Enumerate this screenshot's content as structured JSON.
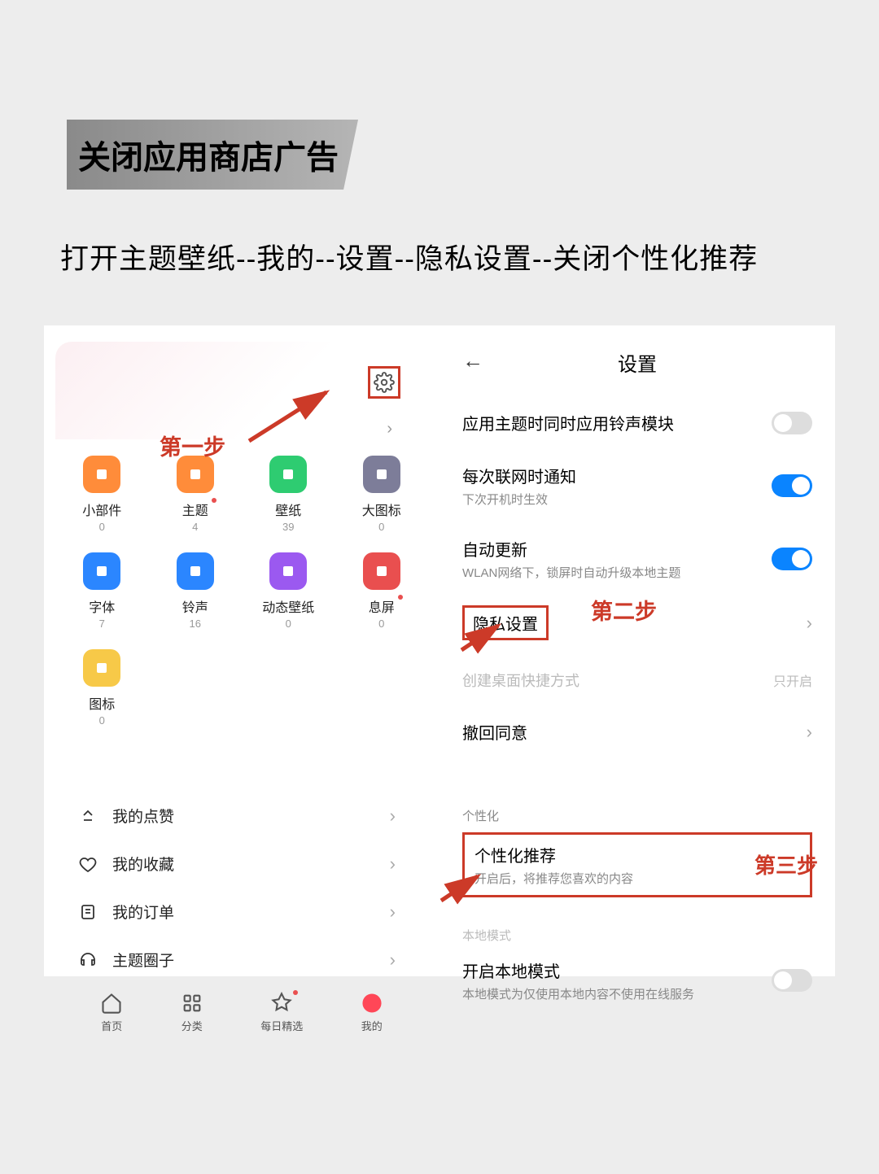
{
  "title": "关闭应用商店广告",
  "instruction": "打开主题壁纸--我的--设置--隐私设置--关闭个性化推荐",
  "step_labels": {
    "step1": "第一步",
    "step2": "第二步",
    "step3": "第三步"
  },
  "left": {
    "grid": [
      {
        "label": "小部件",
        "count": "0",
        "color": "#ff8c3a"
      },
      {
        "label": "主题",
        "count": "4",
        "color": "#ff8c3a",
        "dot": true
      },
      {
        "label": "壁纸",
        "count": "39",
        "color": "#2ecc71"
      },
      {
        "label": "大图标",
        "count": "0",
        "color": "#7d7d99"
      },
      {
        "label": "字体",
        "count": "7",
        "color": "#2b86ff"
      },
      {
        "label": "铃声",
        "count": "16",
        "color": "#2b86ff"
      },
      {
        "label": "动态壁纸",
        "count": "0",
        "color": "#9b59f0"
      },
      {
        "label": "息屏",
        "count": "0",
        "color": "#e94f4f",
        "dot": true
      },
      {
        "label": "图标",
        "count": "0",
        "color": "#f7c948"
      }
    ],
    "menu": [
      {
        "label": "我的点赞"
      },
      {
        "label": "我的收藏"
      },
      {
        "label": "我的订单"
      },
      {
        "label": "主题圈子"
      }
    ],
    "bottom_nav": [
      {
        "label": "首页"
      },
      {
        "label": "分类"
      },
      {
        "label": "每日精选",
        "dot": true
      },
      {
        "label": "我的",
        "active": true
      }
    ]
  },
  "right": {
    "header": "设置",
    "rows": {
      "ringtone": {
        "label": "应用主题时同时应用铃声模块",
        "toggle": "off"
      },
      "network": {
        "label": "每次联网时通知",
        "sub": "下次开机时生效",
        "toggle": "on"
      },
      "auto_update": {
        "label": "自动更新",
        "sub": "WLAN网络下，锁屏时自动升级本地主题",
        "toggle": "on"
      },
      "privacy": {
        "label": "隐私设置"
      },
      "shortcut": {
        "label": "创建桌面快捷方式",
        "value": "只开启"
      },
      "withdraw": {
        "label": "撤回同意"
      }
    },
    "personalization_section": "个性化",
    "personalize": {
      "label": "个性化推荐",
      "sub": "开启后，将推荐您喜欢的内容"
    },
    "local_section": "本地模式",
    "local": {
      "label": "开启本地模式",
      "sub": "本地模式为仅使用本地内容不使用在线服务",
      "toggle": "off"
    }
  }
}
